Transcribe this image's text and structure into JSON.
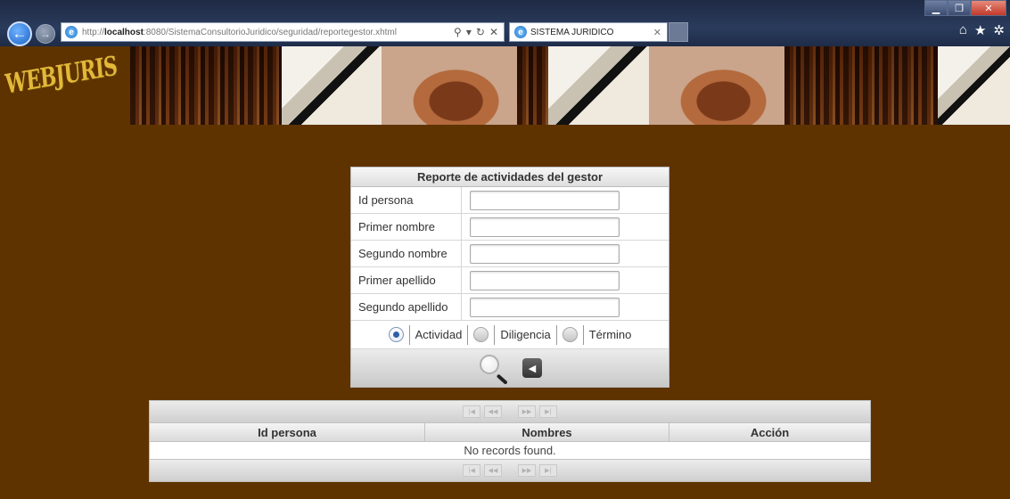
{
  "browser": {
    "url_prefix": "http://",
    "url_host": "localhost",
    "url_rest": ":8080/SistemaConsultorioJuridico/seguridad/reportegestor.xhtml",
    "tab_title": "SISTEMA JURIDICO"
  },
  "site": {
    "logo": "WEBJURIS"
  },
  "form": {
    "title": "Reporte de actividades del gestor",
    "fields": [
      {
        "label": "Id persona",
        "value": ""
      },
      {
        "label": "Primer nombre",
        "value": ""
      },
      {
        "label": "Segundo nombre",
        "value": ""
      },
      {
        "label": "Primer apellido",
        "value": ""
      },
      {
        "label": "Segundo apellido",
        "value": ""
      }
    ],
    "radio_options": [
      {
        "label": "Actividad",
        "selected": true
      },
      {
        "label": "Diligencia",
        "selected": false
      },
      {
        "label": "Término",
        "selected": false
      }
    ]
  },
  "table": {
    "columns": [
      "Id persona",
      "Nombres",
      "Acción"
    ],
    "empty_message": "No records found.",
    "pager": [
      "|◀",
      "◀◀",
      "▶▶",
      "▶|"
    ]
  }
}
